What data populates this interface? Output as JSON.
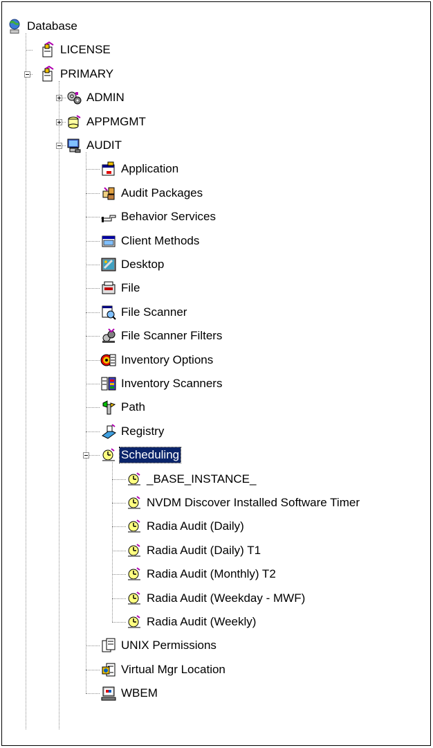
{
  "tree": {
    "root": {
      "label": "Database",
      "icon": "globe-database-icon"
    },
    "license": {
      "label": "LICENSE",
      "icon": "file-cabinet-icon"
    },
    "primary": {
      "label": "PRIMARY",
      "icon": "file-cabinet-icon",
      "expanded": true
    },
    "admin": {
      "label": "ADMIN",
      "icon": "gears-icon",
      "expanded": false
    },
    "appmgmt": {
      "label": "APPMGMT",
      "icon": "stacked-disks-icon",
      "expanded": false
    },
    "audit": {
      "label": "AUDIT",
      "icon": "computer-icon",
      "expanded": true
    },
    "audit_children": [
      {
        "label": "Application",
        "icon": "application-window-icon"
      },
      {
        "label": "Audit Packages",
        "icon": "packages-icon"
      },
      {
        "label": "Behavior Services",
        "icon": "pointing-hand-icon"
      },
      {
        "label": "Client Methods",
        "icon": "client-window-icon"
      },
      {
        "label": "Desktop",
        "icon": "desktop-icon"
      },
      {
        "label": "File",
        "icon": "file-icon"
      },
      {
        "label": "File Scanner",
        "icon": "file-scanner-icon"
      },
      {
        "label": "File Scanner Filters",
        "icon": "filter-icon"
      },
      {
        "label": "Inventory Options",
        "icon": "inventory-options-icon"
      },
      {
        "label": "Inventory Scanners",
        "icon": "inventory-scanners-icon"
      },
      {
        "label": "Path",
        "icon": "path-icon"
      },
      {
        "label": "Registry",
        "icon": "registry-icon"
      }
    ],
    "scheduling": {
      "label": "Scheduling",
      "icon": "scheduling-icon",
      "expanded": true,
      "selected": true
    },
    "scheduling_children": [
      {
        "label": "_BASE_INSTANCE_",
        "icon": "schedule-instance-icon"
      },
      {
        "label": "NVDM Discover Installed Software Timer",
        "icon": "schedule-instance-icon"
      },
      {
        "label": "Radia Audit (Daily)",
        "icon": "schedule-instance-icon"
      },
      {
        "label": "Radia Audit (Daily) T1",
        "icon": "schedule-instance-icon"
      },
      {
        "label": "Radia Audit (Monthly) T2",
        "icon": "schedule-instance-icon"
      },
      {
        "label": "Radia Audit (Weekday - MWF)",
        "icon": "schedule-instance-icon"
      },
      {
        "label": "Radia Audit (Weekly)",
        "icon": "schedule-instance-icon"
      }
    ],
    "audit_tail": [
      {
        "label": "UNIX Permissions",
        "icon": "unix-permissions-icon"
      },
      {
        "label": "Virtual Mgr Location",
        "icon": "virtual-mgr-icon"
      },
      {
        "label": "WBEM",
        "icon": "wbem-monitor-icon"
      }
    ],
    "colors": {
      "selection": "#0a246a",
      "tree_lines": "#8c8c8c"
    }
  }
}
